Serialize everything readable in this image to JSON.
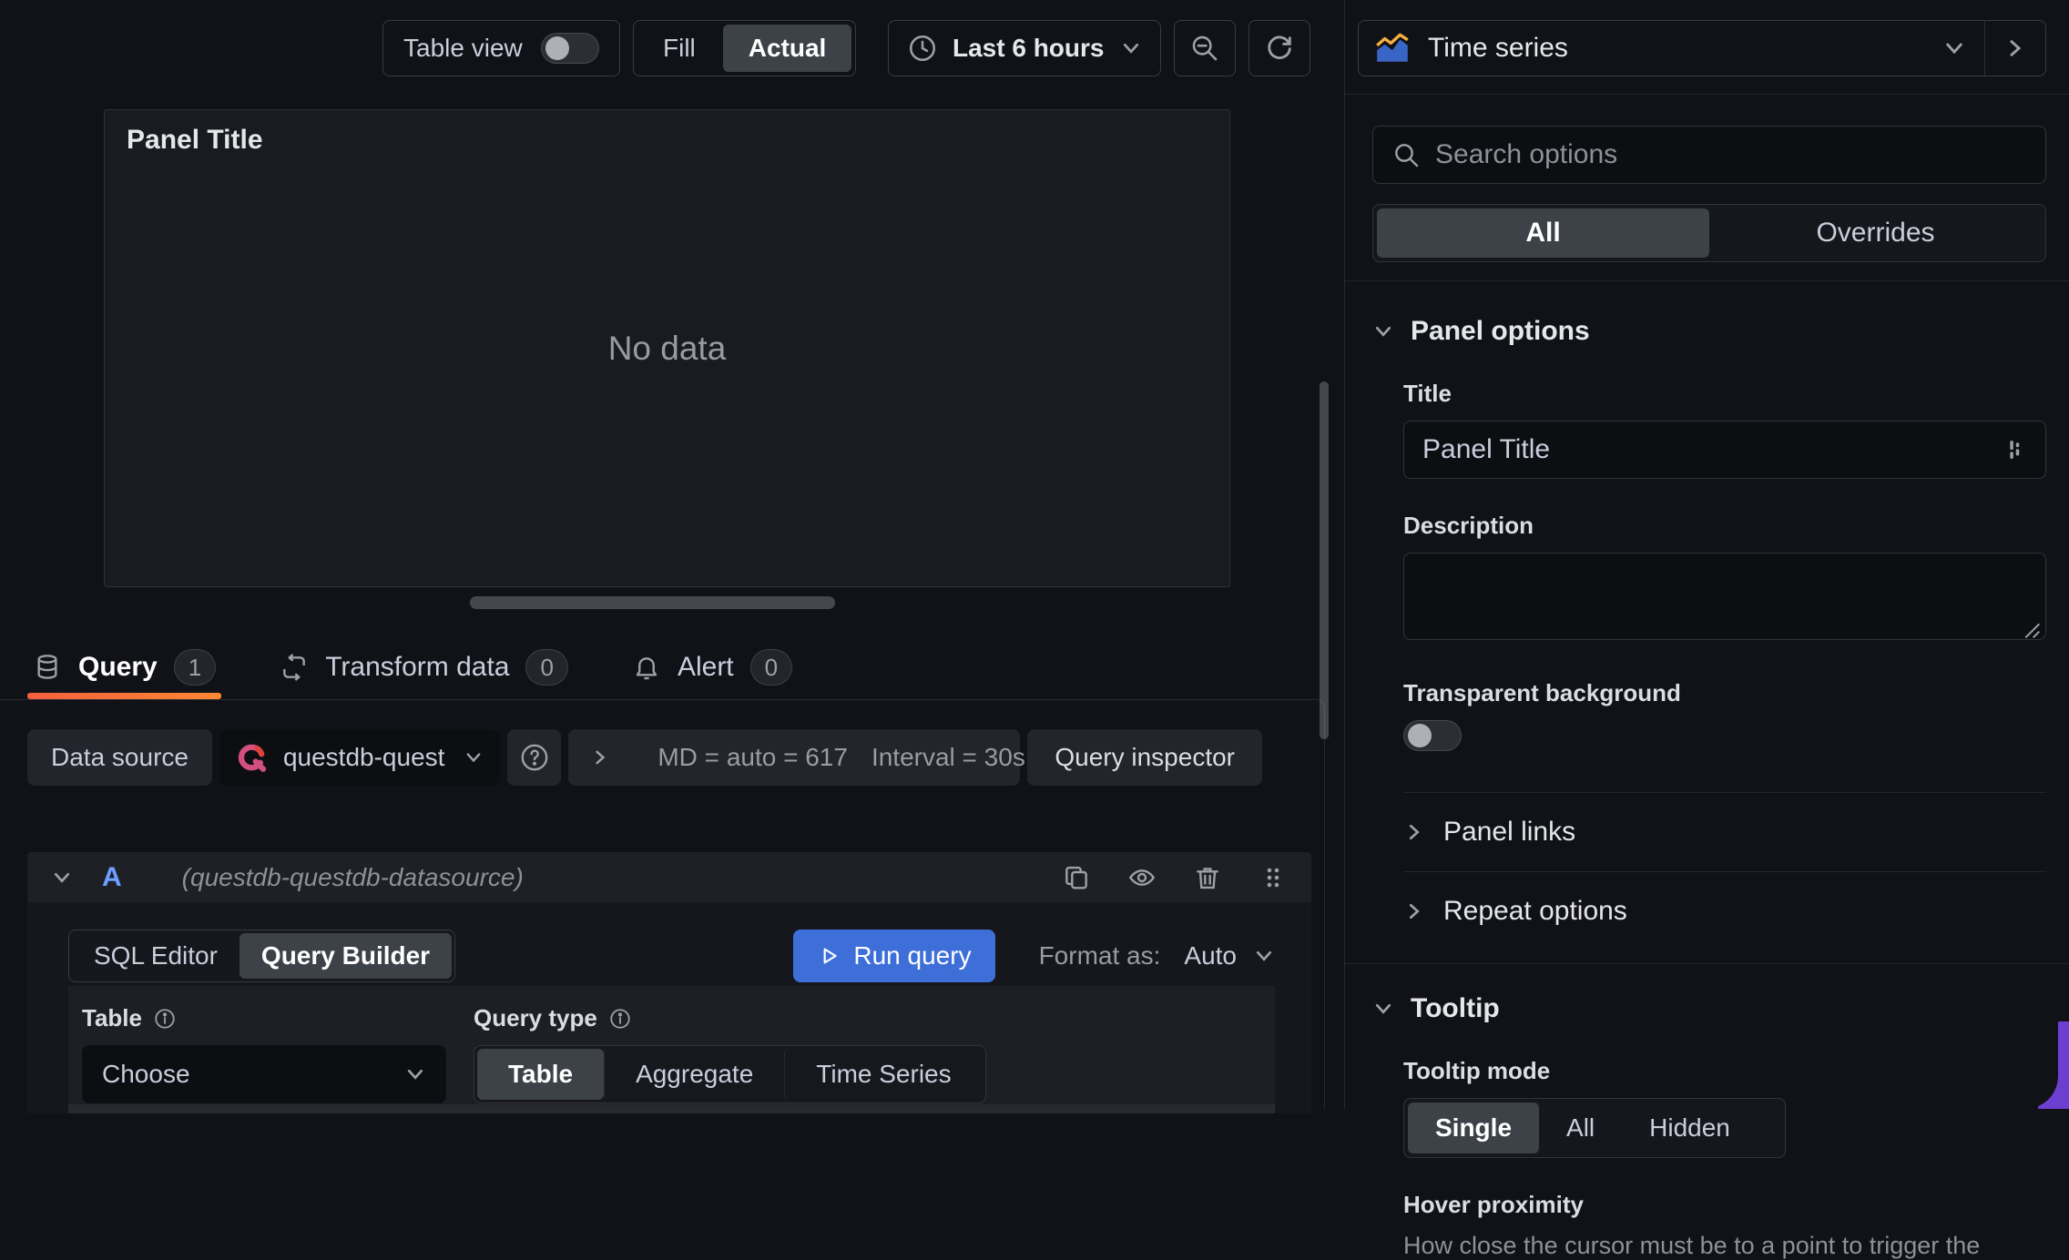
{
  "toolbar": {
    "table_view": "Table view",
    "fill": "Fill",
    "actual": "Actual",
    "time_range": "Last 6 hours"
  },
  "viz_picker": {
    "name": "Time series"
  },
  "panel": {
    "title": "Panel Title",
    "no_data": "No data"
  },
  "tabs": {
    "query": {
      "label": "Query",
      "count": "1"
    },
    "transform": {
      "label": "Transform data",
      "count": "0"
    },
    "alert": {
      "label": "Alert",
      "count": "0"
    }
  },
  "query_toolbar": {
    "datasource_label": "Data source",
    "datasource_name": "questdb-quest",
    "max_data_points": "MD = auto = 617",
    "interval": "Interval = 30s",
    "inspector": "Query inspector"
  },
  "query_row": {
    "ref_id": "A",
    "datasource_hint": "(questdb-questdb-datasource)",
    "mode_sql": "SQL Editor",
    "mode_builder": "Query Builder",
    "run": "Run query",
    "format_label": "Format as:",
    "format_value": "Auto",
    "table_label": "Table",
    "table_value": "Choose",
    "query_type_label": "Query type",
    "qt_table": "Table",
    "qt_aggregate": "Aggregate",
    "qt_timeseries": "Time Series"
  },
  "options": {
    "search_placeholder": "Search options",
    "tab_all": "All",
    "tab_overrides": "Overrides",
    "panel_options": "Panel options",
    "title_label": "Title",
    "title_value": "Panel Title",
    "description_label": "Description",
    "transparent": "Transparent background",
    "panel_links": "Panel links",
    "repeat_options": "Repeat options",
    "tooltip": "Tooltip",
    "tooltip_mode": "Tooltip mode",
    "mode_single": "Single",
    "mode_all": "All",
    "mode_hidden": "Hidden",
    "hover_label": "Hover proximity",
    "hover_desc": "How close the cursor must be to a point to trigger the"
  },
  "colors": {
    "accent_blue": "#3e6fd9",
    "ref_id_blue": "#6e9fff",
    "tab_gradient_start": "#f55f3e",
    "tab_gradient_end": "#ff8833",
    "questdb_pink": "#d34f7d",
    "corner_purple": "#6c3fd0"
  }
}
